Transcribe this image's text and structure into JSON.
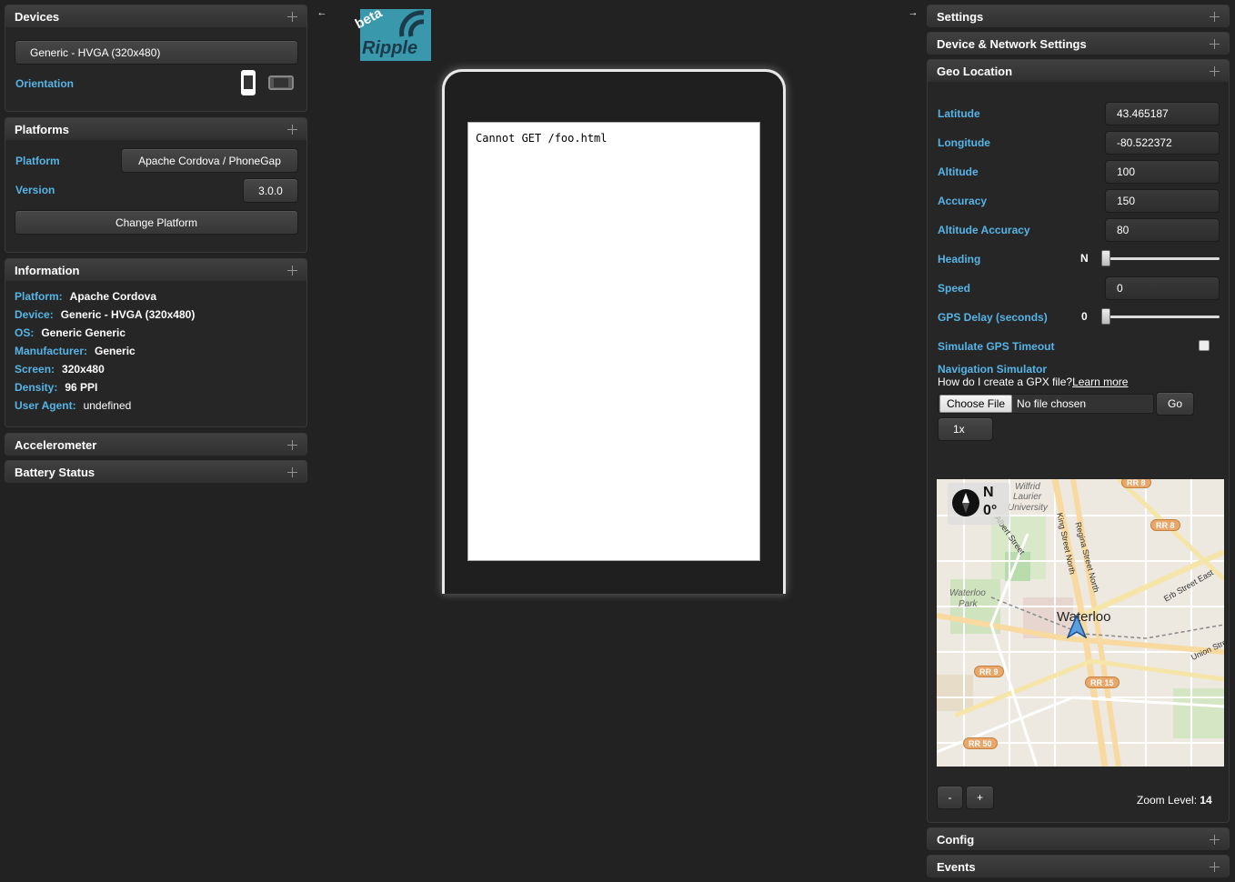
{
  "devices": {
    "title": "Devices",
    "device_select": "Generic - HVGA (320x480)",
    "orientation_label": "Orientation"
  },
  "platforms": {
    "title": "Platforms",
    "platform_label": "Platform",
    "platform_value": "Apache Cordova / PhoneGap",
    "version_label": "Version",
    "version_value": "3.0.0",
    "change_button": "Change Platform"
  },
  "information": {
    "title": "Information",
    "rows": [
      {
        "key": "Platform:",
        "value": "Apache Cordova"
      },
      {
        "key": "Device:",
        "value": "Generic - HVGA (320x480)"
      },
      {
        "key": "OS:",
        "value": "Generic Generic"
      },
      {
        "key": "Manufacturer:",
        "value": "Generic"
      },
      {
        "key": "Screen:",
        "value": "320x480"
      },
      {
        "key": "Density:",
        "value": "96 PPI"
      },
      {
        "key": "User Agent:",
        "value": "undefined"
      }
    ]
  },
  "accelerometer": {
    "title": "Accelerometer"
  },
  "battery": {
    "title": "Battery Status"
  },
  "logo": {
    "beta": "beta",
    "name": "Ripple"
  },
  "screen": {
    "content": "Cannot GET /foo.html"
  },
  "settings": {
    "title": "Settings"
  },
  "network": {
    "title": "Device & Network Settings"
  },
  "geo": {
    "title": "Geo Location",
    "latitude_label": "Latitude",
    "latitude": "43.465187",
    "longitude_label": "Longitude",
    "longitude": "-80.522372",
    "altitude_label": "Altitude",
    "altitude": "100",
    "accuracy_label": "Accuracy",
    "accuracy": "150",
    "altitude_accuracy_label": "Altitude Accuracy",
    "altitude_accuracy": "80",
    "heading_label": "Heading",
    "heading_value": "N",
    "speed_label": "Speed",
    "speed": "0",
    "gps_delay_label": "GPS Delay (seconds)",
    "gps_delay_value": "0",
    "timeout_label": "Simulate GPS Timeout",
    "nav_label": "Navigation Simulator",
    "gpx_question": "How do I create a GPX file?",
    "learn_more": "Learn more",
    "choose_file": "Choose File",
    "no_file": "No file chosen",
    "go": "Go",
    "speed_multiplier": "1x",
    "zoom_out": "-",
    "zoom_in": "+",
    "zoom_label": "Zoom Level:",
    "zoom_value": "14"
  },
  "map": {
    "compass_n": "N",
    "compass_deg": "0°",
    "city": "Waterloo",
    "places": [
      "Wilfrid",
      "Laurier",
      "University",
      "Waterloo",
      "Park"
    ],
    "streets": [
      "Albert Street",
      "King Street North",
      "Regina Street North",
      "Erb Street East",
      "Union Stre"
    ],
    "badges": [
      "RR 8",
      "RR 8",
      "RR 9",
      "RR 15",
      "RR 50"
    ]
  },
  "config": {
    "title": "Config"
  },
  "events": {
    "title": "Events"
  }
}
